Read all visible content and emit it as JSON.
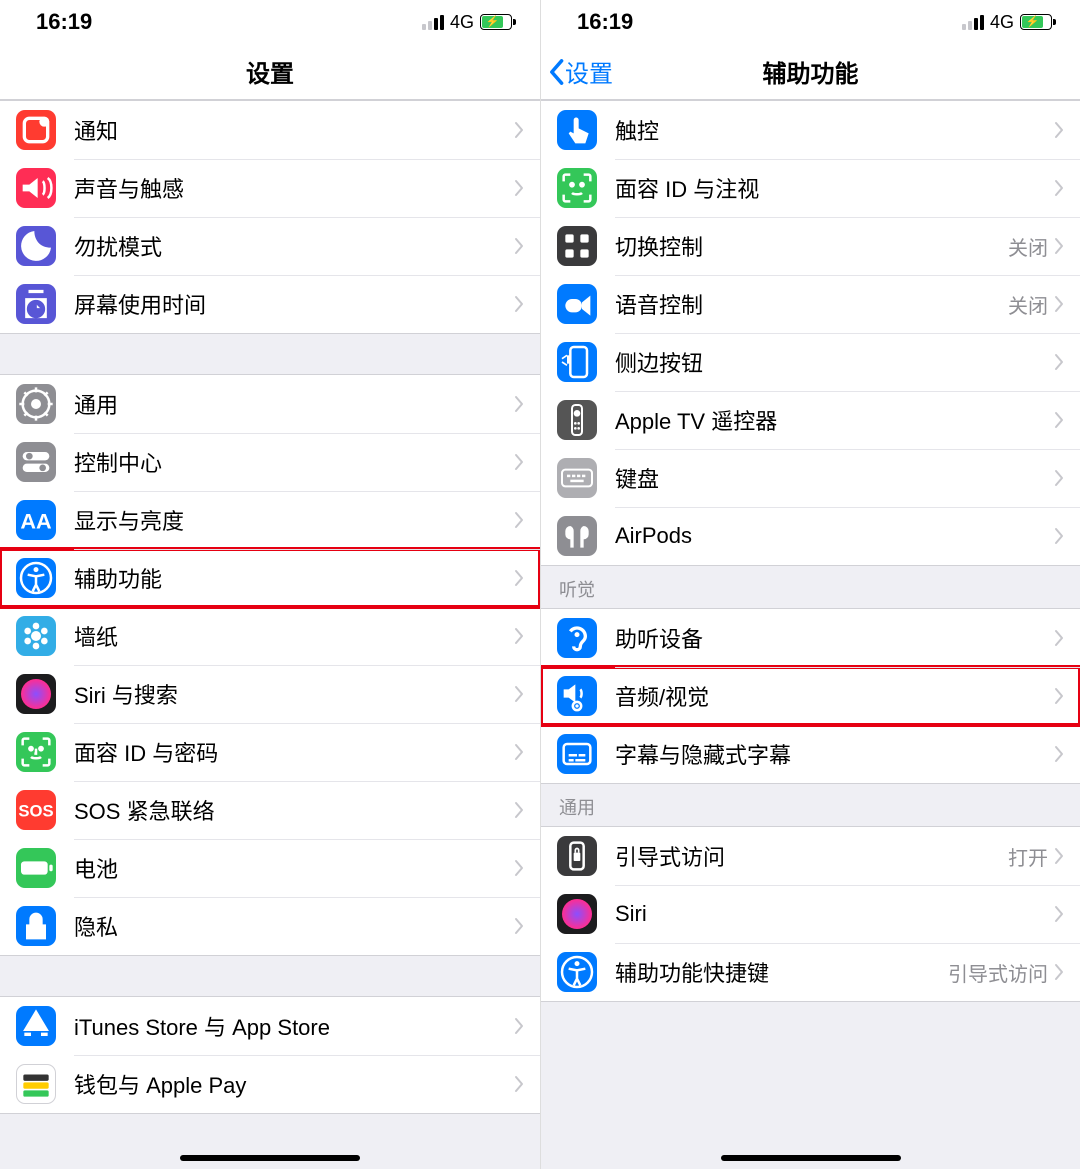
{
  "status": {
    "time": "16:19",
    "network": "4G"
  },
  "left": {
    "title": "设置",
    "group1": [
      {
        "icon": "notifications-icon",
        "bg": "bg-red",
        "label": "通知"
      },
      {
        "icon": "sounds-icon",
        "bg": "bg-pink",
        "label": "声音与触感"
      },
      {
        "icon": "do-not-disturb-icon",
        "bg": "bg-purple",
        "label": "勿扰模式"
      },
      {
        "icon": "screen-time-icon",
        "bg": "bg-purple",
        "label": "屏幕使用时间"
      }
    ],
    "group2": [
      {
        "icon": "general-icon",
        "bg": "bg-gray",
        "label": "通用"
      },
      {
        "icon": "control-center-icon",
        "bg": "bg-gray",
        "label": "控制中心"
      },
      {
        "icon": "display-icon",
        "bg": "bg-blue",
        "label": "显示与亮度"
      },
      {
        "icon": "accessibility-icon",
        "bg": "bg-blue",
        "label": "辅助功能",
        "highlight": true
      },
      {
        "icon": "wallpaper-icon",
        "bg": "bg-cyan",
        "label": "墙纸"
      },
      {
        "icon": "siri-icon",
        "bg": "bg-black",
        "label": "Siri 与搜索"
      },
      {
        "icon": "faceid-icon",
        "bg": "bg-green",
        "label": "面容 ID 与密码"
      },
      {
        "icon": "sos-icon",
        "bg": "bg-red",
        "label": "SOS 紧急联络"
      },
      {
        "icon": "battery-icon",
        "bg": "bg-green",
        "label": "电池"
      },
      {
        "icon": "privacy-icon",
        "bg": "bg-blue",
        "label": "隐私"
      }
    ],
    "group3": [
      {
        "icon": "app-store-icon",
        "bg": "bg-blue",
        "label": "iTunes Store 与 App Store"
      },
      {
        "icon": "wallet-icon",
        "bg": "bg-white",
        "label": "钱包与 Apple Pay"
      }
    ]
  },
  "right": {
    "back": "设置",
    "title": "辅助功能",
    "group1": [
      {
        "icon": "touch-icon",
        "bg": "bg-blue",
        "label": "触控"
      },
      {
        "icon": "faceid-attention-icon",
        "bg": "bg-green",
        "label": "面容 ID 与注视"
      },
      {
        "icon": "switch-control-icon",
        "bg": "bg-dark",
        "label": "切换控制",
        "detail": "关闭"
      },
      {
        "icon": "voice-control-icon",
        "bg": "bg-blue",
        "label": "语音控制",
        "detail": "关闭"
      },
      {
        "icon": "side-button-icon",
        "bg": "bg-blue",
        "label": "侧边按钮"
      },
      {
        "icon": "apple-tv-remote-icon",
        "bg": "bg-darkgray",
        "label": "Apple TV 遥控器"
      },
      {
        "icon": "keyboard-icon",
        "bg": "bg-lgray",
        "label": "键盘"
      },
      {
        "icon": "airpods-icon",
        "bg": "bg-gray",
        "label": "AirPods"
      }
    ],
    "hearing_header": "听觉",
    "group2": [
      {
        "icon": "hearing-devices-icon",
        "bg": "bg-blue",
        "label": "助听设备"
      },
      {
        "icon": "audio-visual-icon",
        "bg": "bg-blue",
        "label": "音频/视觉",
        "highlight": true
      },
      {
        "icon": "subtitles-icon",
        "bg": "bg-blue",
        "label": "字幕与隐藏式字幕"
      }
    ],
    "general_header": "通用",
    "group3": [
      {
        "icon": "guided-access-icon",
        "bg": "bg-dark",
        "label": "引导式访问",
        "detail": "打开"
      },
      {
        "icon": "siri-icon",
        "bg": "bg-black",
        "label": "Siri"
      },
      {
        "icon": "accessibility-shortcut-icon",
        "bg": "bg-blue",
        "label": "辅助功能快捷键",
        "detail": "引导式访问"
      }
    ]
  }
}
